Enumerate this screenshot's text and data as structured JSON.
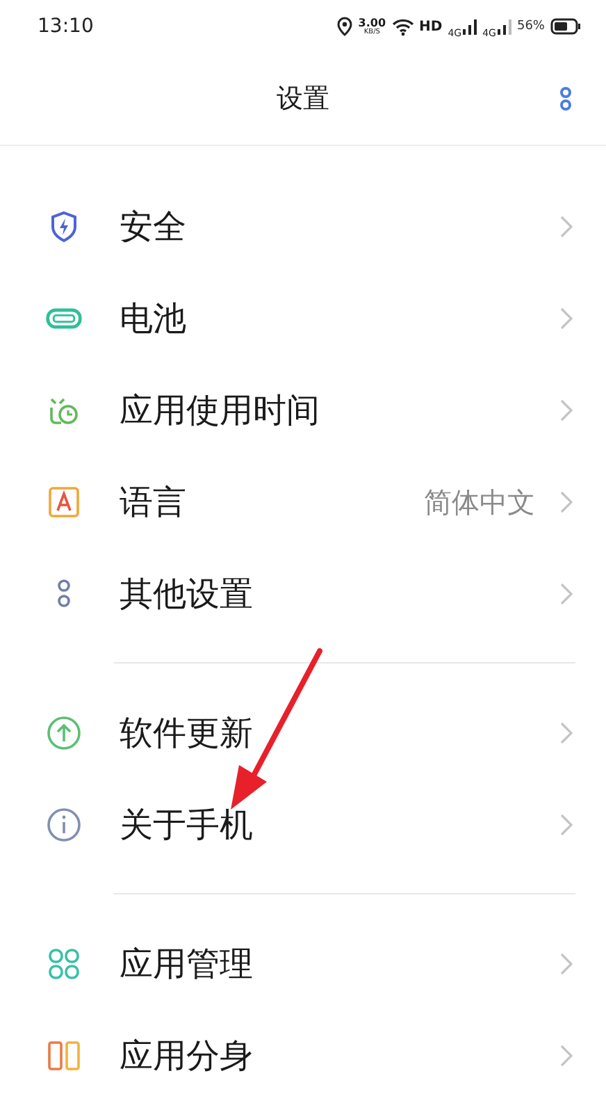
{
  "status_bar": {
    "time": "13:10",
    "speed_value": "3.00",
    "speed_unit": "KB/S",
    "hd": "HD",
    "network_1": "4G",
    "network_2": "4G",
    "battery": "56%"
  },
  "header": {
    "title": "设置"
  },
  "sections": [
    {
      "items": [
        {
          "kind": "shield",
          "label": "安全"
        },
        {
          "kind": "battery",
          "label": "电池"
        },
        {
          "kind": "clock",
          "label": "应用使用时间"
        },
        {
          "kind": "language",
          "label": "语言",
          "value": "简体中文"
        },
        {
          "kind": "dots",
          "label": "其他设置"
        }
      ]
    },
    {
      "items": [
        {
          "kind": "update",
          "label": "软件更新"
        },
        {
          "kind": "info",
          "label": "关于手机"
        }
      ]
    },
    {
      "items": [
        {
          "kind": "grid",
          "label": "应用管理"
        },
        {
          "kind": "dual",
          "label": "应用分身"
        }
      ]
    }
  ]
}
